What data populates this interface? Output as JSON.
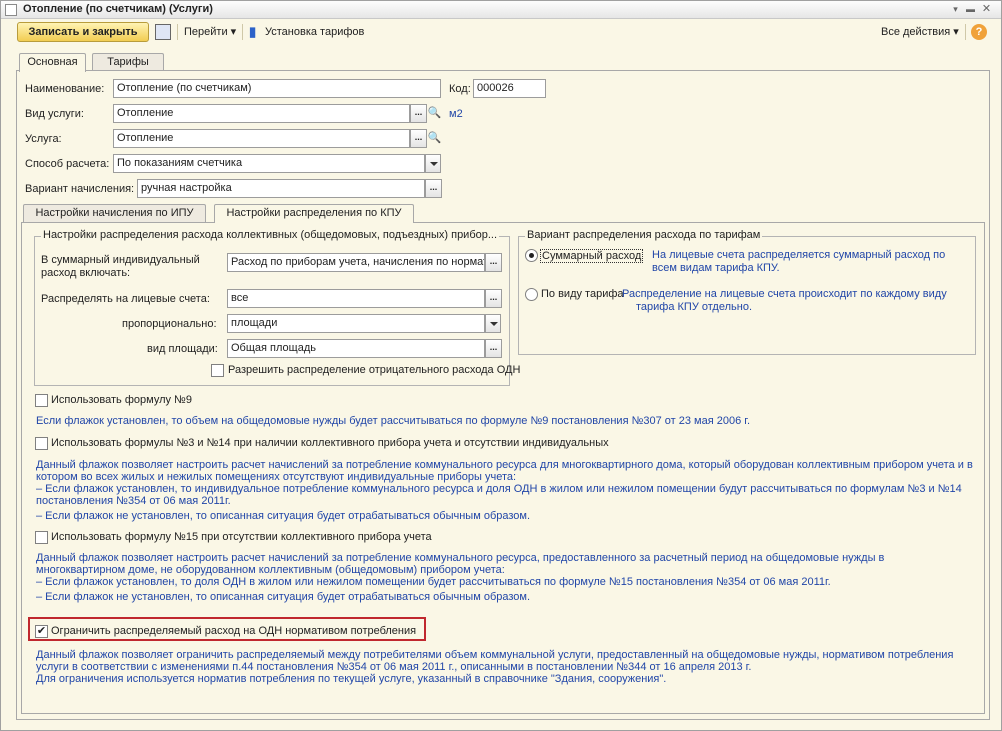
{
  "window": {
    "title": "Отопление (по счетчикам) (Услуги)"
  },
  "toolbar": {
    "save_close": "Записать и закрыть",
    "goto": "Перейти",
    "tariffs": "Установка тарифов",
    "all_actions": "Все действия"
  },
  "tabs": [
    "Основная",
    "Тарифы"
  ],
  "form": {
    "name_label": "Наименование:",
    "name_value": "Отопление (по счетчикам)",
    "code_label": "Код:",
    "code_value": "000026",
    "service_type_label": "Вид услуги:",
    "service_type_value": "Отопление",
    "unit": "м2",
    "service_label": "Услуга:",
    "service_value": "Отопление",
    "calc_method_label": "Способ расчета:",
    "calc_method_value": "По показаниям счетчика",
    "accrual_label": "Вариант начисления:",
    "accrual_value": "ручная настройка"
  },
  "inner_tabs": [
    "Настройки начисления по ИПУ",
    "Настройки распределения по КПУ"
  ],
  "kpu": {
    "group_title": "Настройки распределения расхода коллективных (общедомовых, подъездных) прибор...",
    "include_label_1": "В суммарный индивидуальный",
    "include_label_2": "расход включать:",
    "include_value": "Расход по приборам учета, начисления по нормати",
    "distribute_label": "Распределять на лицевые счета:",
    "distribute_value": "все",
    "proportional_label": "пропорционально:",
    "proportional_value": "площади",
    "area_label": "вид площади:",
    "area_value": "Общая площадь",
    "allow_negative": "Разрешить распределение отрицательного расхода ОДН"
  },
  "tariff_variant": {
    "title": "Вариант распределения расхода по тарифам",
    "opt1": "Суммарный расход",
    "opt1_desc_1": "На лицевые счета распределяется суммарный расход по",
    "opt1_desc_2": "всем видам тарифа КПУ.",
    "opt2": "По виду тарифа",
    "opt2_desc_1": "Распределение на лицевые счета происходит по каждому виду",
    "opt2_desc_2": "тарифа КПУ отдельно."
  },
  "options": {
    "f9_label": "Использовать формулу №9",
    "f9_desc": "Если флажок установлен, то объем на общедомовые нужды будет рассчитываться по формуле №9 постановления №307 от 23 мая 2006 г.",
    "f3_label": "Использовать формулы №3 и №14 при наличии коллективного прибора учета и отсутствии индивидуальных",
    "f3_desc": [
      "Данный флажок позволяет настроить расчет начислений за потребление коммунального ресурса для многоквартирного дома, который оборудован коллективным прибором учета и в",
      "котором во всех жилых и нежилых помещениях отсутствуют индивидуальные приборы учета:",
      "– Если флажок установлен, то индивидуальное потребление коммунального ресурса и доля ОДН в жилом или нежилом помещении будут рассчитываться по формулам №3 и №14",
      "постановления №354 от 06 мая 2011г.",
      "– Если флажок не установлен, то описанная ситуация будет отрабатываться обычным образом."
    ],
    "f15_label": "Использовать формулу №15 при отсутствии коллективного прибора учета",
    "f15_desc": [
      "Данный флажок позволяет настроить расчет начислений за потребление коммунального ресурса, предоставленного за расчетный период на общедомовые нужды в",
      "многоквартирном доме, не оборудованном коллективным (общедомовым) прибором учета:",
      "– Если флажок установлен, то доля ОДН в жилом или нежилом помещении будет рассчитываться по формуле №15 постановления №354 от 06 мая 2011г.",
      "– Если флажок не установлен, то описанная ситуация будет отрабатываться обычным образом."
    ],
    "limit_label": "Ограничить распределяемый расход на ОДН нормативом потребления",
    "limit_desc": [
      "Данный флажок позволяет ограничить распределяемый между потребителями объем коммунальной услуги, предоставленный на общедомовые нужды, нормативом потребления",
      "услуги в соответствии с изменениями п.44 постановления №354 от 06 мая 2011 г., описанными в постановлении №344 от 16 апреля 2013 г.",
      "Для ограничения используется норматив потребления по текущей услуге, указанный в справочнике \"Здания, сооружения\"."
    ]
  }
}
